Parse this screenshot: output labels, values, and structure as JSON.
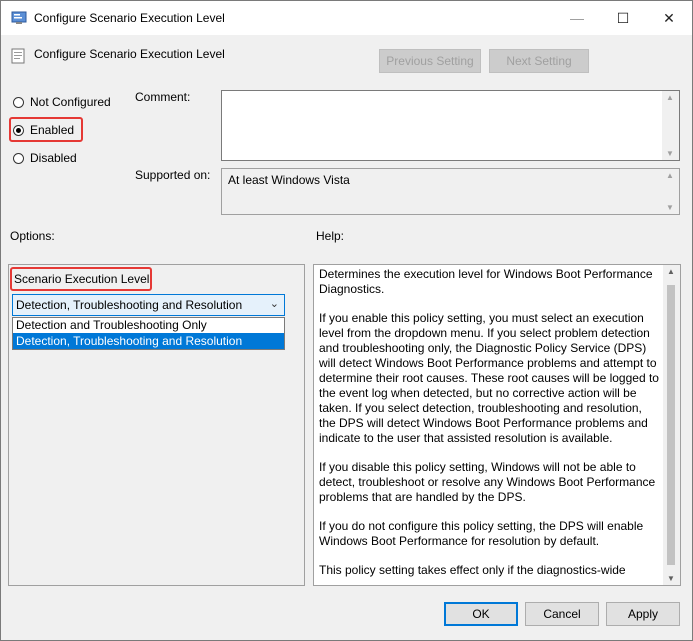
{
  "window": {
    "title": "Configure Scenario Execution Level",
    "minimize": "—",
    "maximize": "☐",
    "close": "✕"
  },
  "header": {
    "policy_name": "Configure Scenario Execution Level",
    "prev_button": "Previous Setting",
    "next_button": "Next Setting"
  },
  "state": {
    "not_configured": "Not Configured",
    "enabled": "Enabled",
    "disabled": "Disabled",
    "selected": "Enabled"
  },
  "comment_label": "Comment:",
  "supported_label": "Supported on:",
  "supported_value": "At least Windows Vista",
  "options_label": "Options:",
  "help_label": "Help:",
  "options": {
    "field_label": "Scenario Execution Level",
    "dropdown_value": "Detection, Troubleshooting and Resolution",
    "dropdown_items": [
      "Detection and Troubleshooting Only",
      "Detection, Troubleshooting and Resolution"
    ]
  },
  "help": {
    "paragraphs": [
      "Determines the execution level for Windows Boot Performance Diagnostics.",
      "If you enable this policy setting, you must select an execution level from the dropdown menu. If you select problem detection and troubleshooting only, the Diagnostic Policy Service (DPS) will detect Windows Boot Performance problems and attempt to determine their root causes. These root causes will be logged to the event log when detected, but no corrective action will be taken. If you select detection, troubleshooting and resolution, the DPS will detect Windows Boot Performance problems and indicate to the user that assisted resolution is available.",
      "If you disable this policy setting, Windows will not be able to detect, troubleshoot or resolve any Windows Boot Performance problems that are handled by the DPS.",
      "If you do not configure this policy setting, the DPS will enable Windows Boot Performance for resolution by default.",
      "This policy setting takes effect only if the diagnostics-wide"
    ]
  },
  "footer": {
    "ok": "OK",
    "cancel": "Cancel",
    "apply": "Apply"
  },
  "colors": {
    "highlight": "#0078d7",
    "annotation_red": "#e53935"
  }
}
